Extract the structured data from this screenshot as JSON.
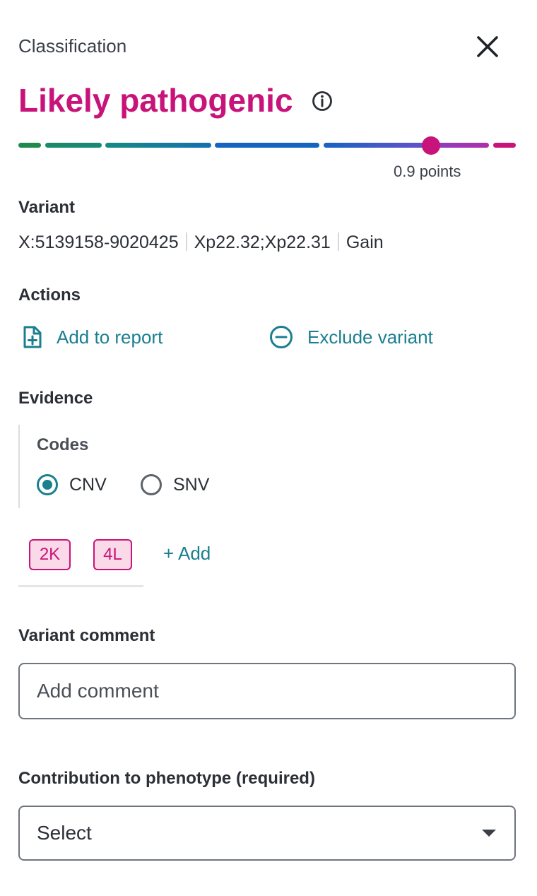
{
  "header": {
    "label": "Classification",
    "close_icon": "close-icon"
  },
  "classification": {
    "title": "Likely pathogenic",
    "title_color": "#c8147a",
    "info_icon": "info-icon",
    "scale": {
      "points_label": "0.9 points",
      "marker_position_fraction": 0.81,
      "segment_colors": [
        "#1f8a4c",
        "#17897a",
        "#1480a0",
        "#1565c0",
        "#1565c0",
        "#5b4fc8",
        "#a83cb8",
        "#c8147a"
      ]
    }
  },
  "variant": {
    "heading": "Variant",
    "coordinates": "X:5139158-9020425",
    "cytoband": "Xp22.32;Xp22.31",
    "type": "Gain"
  },
  "actions": {
    "heading": "Actions",
    "add_to_report": {
      "label": "Add to report",
      "icon": "file-plus-icon"
    },
    "exclude_variant": {
      "label": "Exclude variant",
      "icon": "minus-circle-icon"
    },
    "accent_color": "#1a7f8f"
  },
  "evidence": {
    "heading": "Evidence",
    "codes_heading": "Codes",
    "options": [
      {
        "label": "CNV",
        "selected": true
      },
      {
        "label": "SNV",
        "selected": false
      }
    ],
    "codes": [
      "2K",
      "4L"
    ],
    "add_label": "+ Add"
  },
  "variant_comment": {
    "heading": "Variant comment",
    "placeholder": "Add comment",
    "value": ""
  },
  "phenotype": {
    "heading": "Contribution to phenotype (required)",
    "selected_value": "Select",
    "dropdown_icon": "caret-down-icon"
  }
}
